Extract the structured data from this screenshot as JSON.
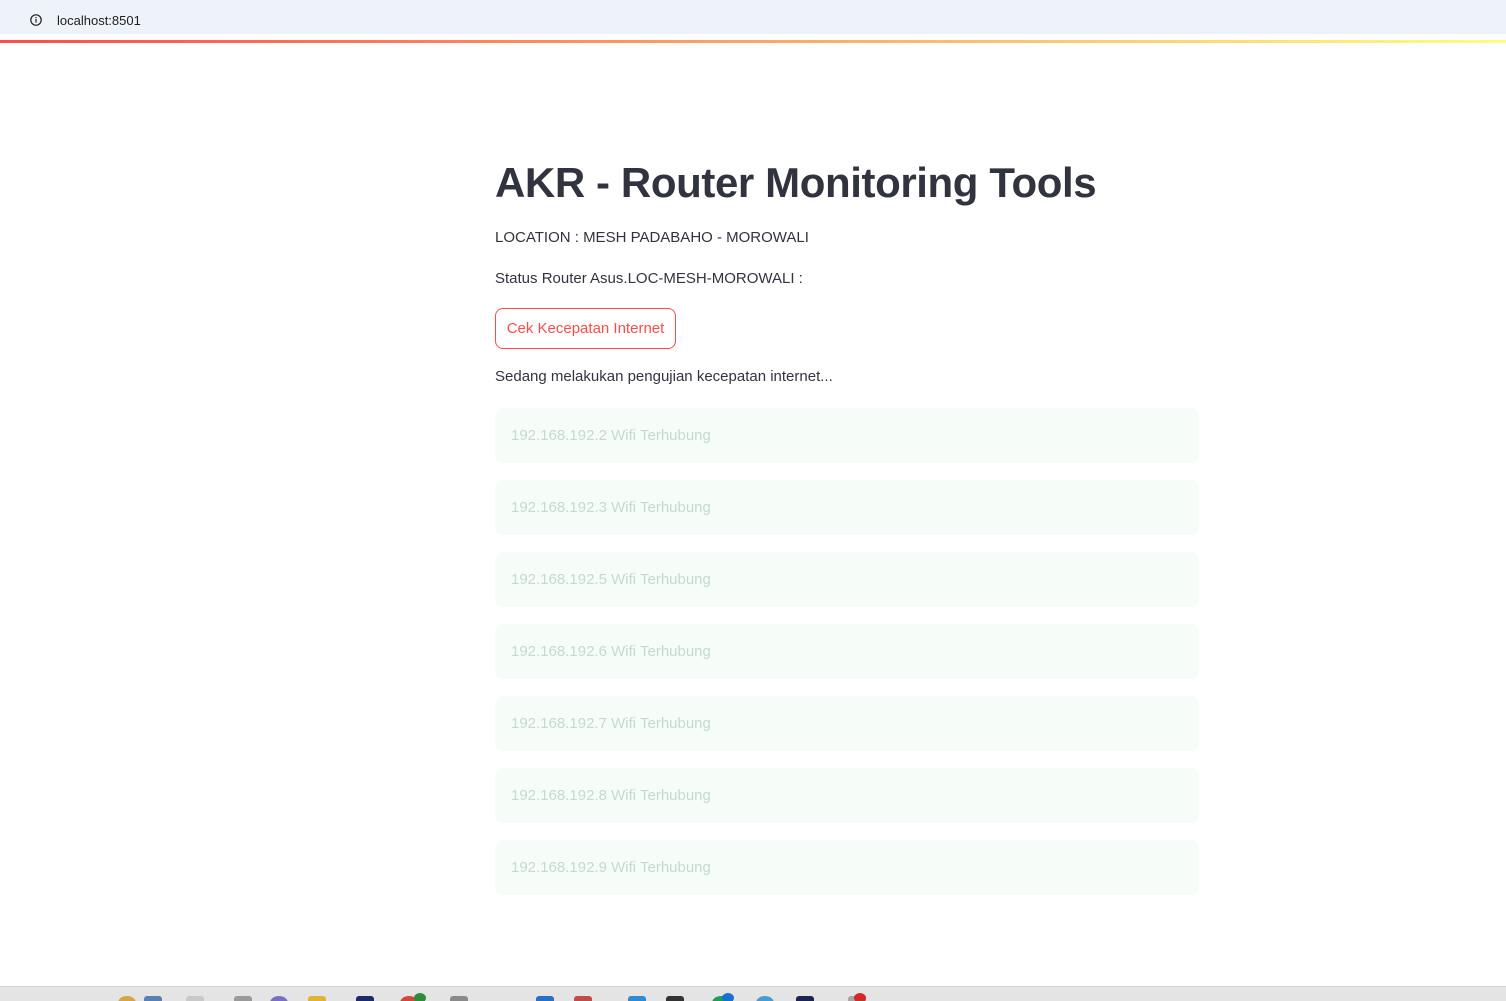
{
  "browser": {
    "url": "localhost:8501",
    "info_icon": "info-icon"
  },
  "theme": {
    "accent": "#ff4b4b",
    "text": "#31333f",
    "alert_bg": "#f6fcf8",
    "alert_text": "#c3dbcd"
  },
  "app": {
    "title": "AKR - Router Monitoring Tools",
    "location": "LOCATION : MESH PADABAHO - MOROWALI",
    "status_label": "Status Router Asus.LOC-MESH-MOROWALI :",
    "speed_test_button": "Cek Kecepatan Internet",
    "progress_message": "Sedang melakukan pengujian kecepatan internet..."
  },
  "devices": [
    {
      "message": "192.168.192.2 Wifi Terhubung"
    },
    {
      "message": "192.168.192.3 Wifi Terhubung"
    },
    {
      "message": "192.168.192.5 Wifi Terhubung"
    },
    {
      "message": "192.168.192.6 Wifi Terhubung"
    },
    {
      "message": "192.168.192.7 Wifi Terhubung"
    },
    {
      "message": "192.168.192.8 Wifi Terhubung"
    },
    {
      "message": "192.168.192.9 Wifi Terhubung"
    }
  ]
}
